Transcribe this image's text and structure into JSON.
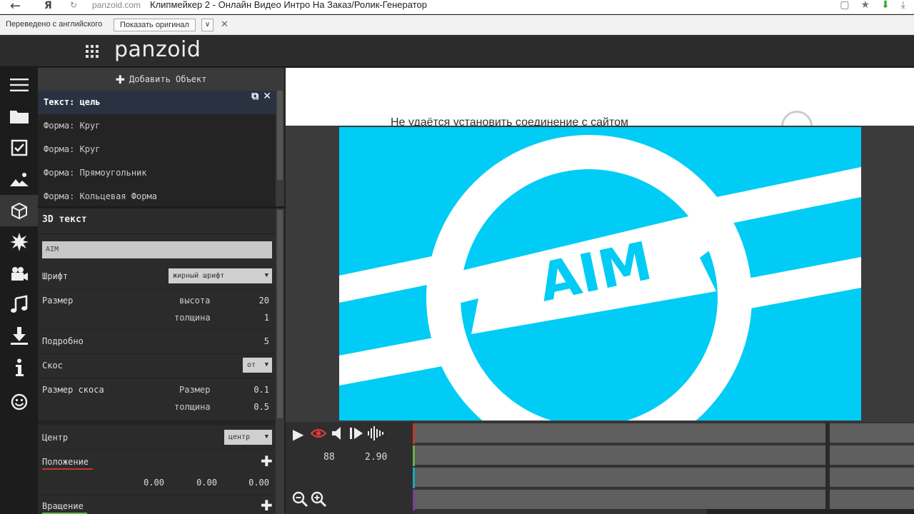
{
  "browser": {
    "domain": "panzoid.com",
    "title": "Клипмейкер 2 - Онлайн Видео Интро На Заказ/Ролик-Генератор",
    "back_glyph": "←",
    "ya_glyph": "Я",
    "reload_glyph": "↻"
  },
  "translate_bar": {
    "label": "Переведено с английского",
    "show_original": "Показать оригинал",
    "dropdown_glyph": "∨",
    "close_glyph": "✕"
  },
  "app": {
    "logo": "panzoid"
  },
  "rail": {
    "icons": [
      "menu-icon",
      "folder-icon",
      "checkbox-icon",
      "image-icon",
      "cube-icon",
      "burst-icon",
      "camera-icon",
      "music-icon",
      "download-icon",
      "info-icon",
      "smiley-icon"
    ]
  },
  "objects": {
    "add_label": "Добавить Объект",
    "items": [
      "Текст: цель",
      "Форма: Круг",
      "Форма: Круг",
      "Форма: Прямоугольник",
      "Форма: Кольцевая Форма"
    ],
    "selected_index": 0
  },
  "props": {
    "title": "3D текст",
    "text_value": "AIM",
    "font_label": "Шрифт",
    "font_value": "жирный шрифт",
    "size_label": "Размер",
    "height_label": "высота",
    "height_value": "20",
    "thickness_label": "толщина",
    "thickness_value": "1",
    "detail_label": "Подробно",
    "detail_value": "5",
    "bevel_label": "Скос",
    "bevel_value": "от",
    "bevel_size_label": "Размер скоса",
    "bevel_size_sub": "Размер",
    "bevel_size_value": "0.1",
    "bevel_thickness_sub": "толщина",
    "bevel_thickness_value": "0.5",
    "center_label": "Центр",
    "center_value": "центр",
    "position_label": "Положение",
    "position_x": "0.00",
    "position_y": "0.00",
    "position_z": "0.00",
    "rotation_label": "Вращение"
  },
  "preview": {
    "error_text": "Не удаётся установить соединение с сайтом",
    "canvas_text": "AIM",
    "colors": {
      "canvas_bg": "#00ccf5",
      "shape_white": "#ffffff"
    }
  },
  "timeline": {
    "frame": "88",
    "time": "2.90",
    "track_colors": [
      "#c0392b",
      "#6ab04c",
      "#1aa7b8",
      "#7d3c98"
    ]
  }
}
